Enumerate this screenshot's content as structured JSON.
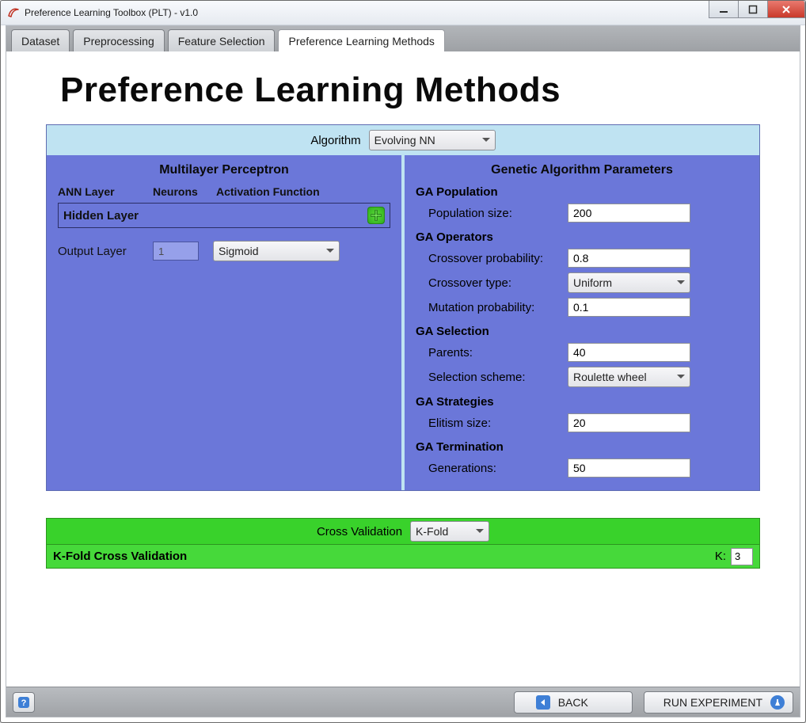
{
  "window_title": "Preference Learning Toolbox (PLT) - v1.0",
  "tabs": [
    "Dataset",
    "Preprocessing",
    "Feature Selection",
    "Preference Learning Methods"
  ],
  "active_tab": 3,
  "page_heading": "Preference Learning Methods",
  "algorithm_label": "Algorithm",
  "algorithm_value": "Evolving NN",
  "mlp": {
    "section_title": "Multilayer Perceptron",
    "headers": {
      "layer": "ANN Layer",
      "neurons": "Neurons",
      "activation": "Activation Function"
    },
    "hidden_layer_label": "Hidden Layer",
    "output_layer_label": "Output Layer",
    "output_neurons": "1",
    "output_activation": "Sigmoid"
  },
  "ga": {
    "section_title": "Genetic Algorithm Parameters",
    "groups": {
      "population": {
        "title": "GA Population",
        "population_size_label": "Population size:",
        "population_size": "200"
      },
      "operators": {
        "title": "GA Operators",
        "crossover_prob_label": "Crossover probability:",
        "crossover_prob": "0.8",
        "crossover_type_label": "Crossover type:",
        "crossover_type": "Uniform",
        "mutation_prob_label": "Mutation probability:",
        "mutation_prob": "0.1"
      },
      "selection": {
        "title": "GA Selection",
        "parents_label": "Parents:",
        "parents": "40",
        "scheme_label": "Selection scheme:",
        "scheme": "Roulette wheel"
      },
      "strategies": {
        "title": "GA Strategies",
        "elitism_label": "Elitism size:",
        "elitism": "20"
      },
      "termination": {
        "title": "GA Termination",
        "generations_label": "Generations:",
        "generations": "50"
      }
    }
  },
  "cv": {
    "label": "Cross Validation",
    "method": "K-Fold",
    "panel_title": "K-Fold Cross Validation",
    "k_label": "K:",
    "k_value": "3"
  },
  "buttons": {
    "back": "BACK",
    "run": "RUN EXPERIMENT"
  }
}
